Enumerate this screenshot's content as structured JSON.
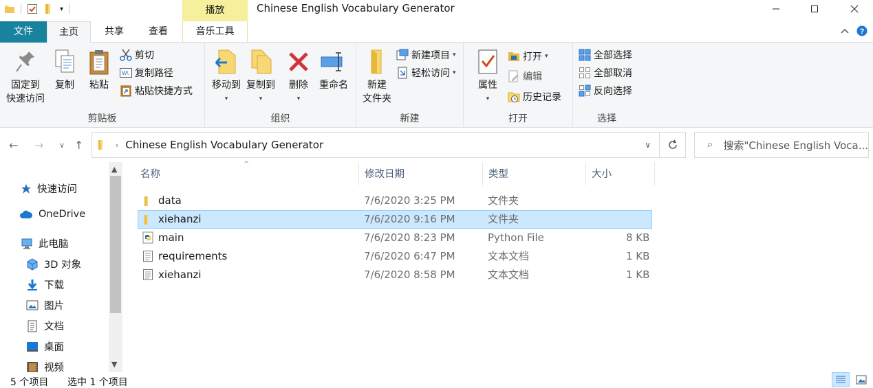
{
  "window": {
    "title": "Chinese English Vocabulary Generator",
    "context_tab_group": "播放"
  },
  "ribbon_tabs": [
    "文件",
    "主页",
    "共享",
    "查看",
    "音乐工具"
  ],
  "clipboard": {
    "pin_label_1": "固定到",
    "pin_label_2": "快速访问",
    "copy": "复制",
    "paste": "粘贴",
    "cut": "剪切",
    "copy_path": "复制路径",
    "paste_shortcut": "粘贴快捷方式",
    "group": "剪贴板"
  },
  "organize": {
    "move_to": "移动到",
    "copy_to": "复制到",
    "delete": "删除",
    "rename": "重命名",
    "group": "组织"
  },
  "new": {
    "new_folder_1": "新建",
    "new_folder_2": "文件夹",
    "new_item": "新建项目",
    "easy_access": "轻松访问",
    "group": "新建"
  },
  "open": {
    "properties": "属性",
    "open": "打开",
    "edit": "编辑",
    "history": "历史记录",
    "group": "打开"
  },
  "select": {
    "select_all": "全部选择",
    "select_none": "全部取消",
    "invert": "反向选择",
    "group": "选择"
  },
  "address": {
    "path": "Chinese English Vocabulary Generator",
    "search_placeholder": "搜索\"Chinese English Voca..."
  },
  "nav_pane": [
    {
      "label": "快速访问",
      "icon": "star-icon"
    },
    {
      "label": "OneDrive",
      "icon": "cloud-icon"
    },
    {
      "label": "此电脑",
      "icon": "computer-icon"
    },
    {
      "label": "3D 对象",
      "icon": "cube-icon"
    },
    {
      "label": "下载",
      "icon": "download-icon"
    },
    {
      "label": "图片",
      "icon": "pictures-icon"
    },
    {
      "label": "文档",
      "icon": "documents-icon"
    },
    {
      "label": "桌面",
      "icon": "desktop-icon"
    },
    {
      "label": "视频",
      "icon": "video-icon"
    }
  ],
  "columns": {
    "name": "名称",
    "date": "修改日期",
    "type": "类型",
    "size": "大小"
  },
  "files": [
    {
      "name": "data",
      "date": "7/6/2020 3:25 PM",
      "type": "文件夹",
      "size": "",
      "icon": "folder-icon",
      "selected": false
    },
    {
      "name": "xiehanzi",
      "date": "7/6/2020 9:16 PM",
      "type": "文件夹",
      "size": "",
      "icon": "folder-icon",
      "selected": true
    },
    {
      "name": "main",
      "date": "7/6/2020 8:23 PM",
      "type": "Python File",
      "size": "8 KB",
      "icon": "python-file-icon",
      "selected": false
    },
    {
      "name": "requirements",
      "date": "7/6/2020 6:47 PM",
      "type": "文本文档",
      "size": "1 KB",
      "icon": "text-file-icon",
      "selected": false
    },
    {
      "name": "xiehanzi",
      "date": "7/6/2020 8:58 PM",
      "type": "文本文档",
      "size": "1 KB",
      "icon": "text-file-icon",
      "selected": false
    }
  ],
  "status": {
    "item_count": "5 个项目",
    "selected": "选中 1 个项目"
  }
}
